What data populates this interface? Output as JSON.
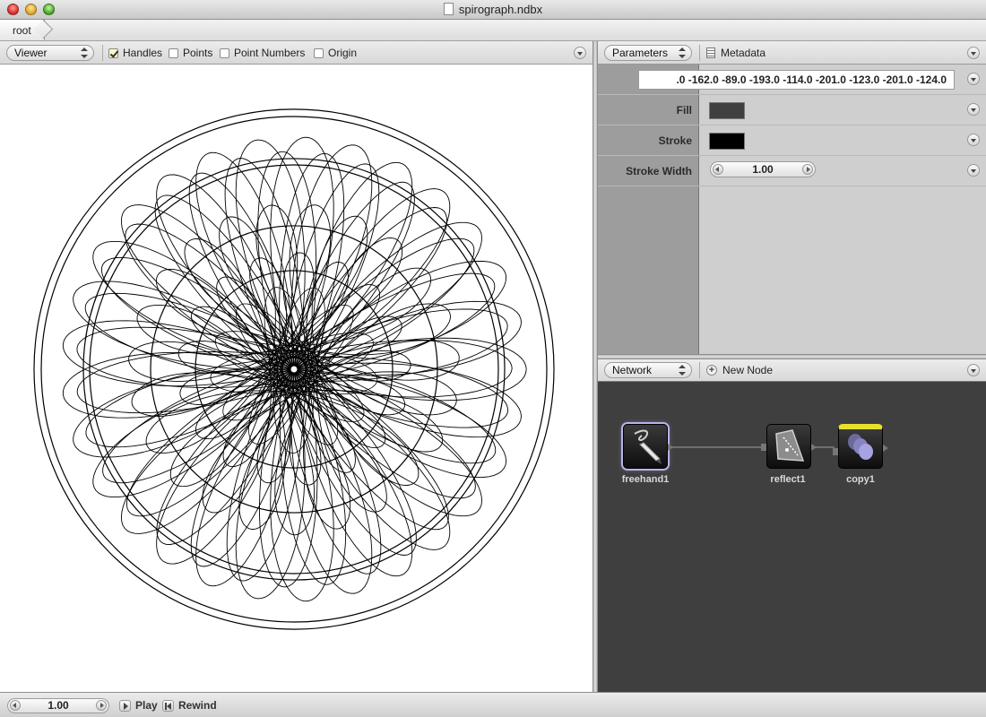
{
  "window": {
    "title": "spirograph.ndbx"
  },
  "breadcrumb": {
    "root": "root"
  },
  "viewer": {
    "selector": "Viewer",
    "options": [
      {
        "label": "Handles",
        "checked": true
      },
      {
        "label": "Points",
        "checked": false
      },
      {
        "label": "Point Numbers",
        "checked": false
      },
      {
        "label": "Origin",
        "checked": false
      }
    ]
  },
  "parameters": {
    "selector": "Parameters",
    "metadata_label": "Metadata",
    "path_value": ".0 -162.0 -89.0 -193.0 -114.0 -201.0 -123.0 -201.0 -124.0",
    "fill_label": "Fill",
    "fill_color": "#404040",
    "stroke_label": "Stroke",
    "stroke_color": "#000000",
    "stroke_width_label": "Stroke Width",
    "stroke_width_value": "1.00"
  },
  "network": {
    "selector": "Network",
    "new_node_label": "New Node",
    "nodes": [
      {
        "name": "freehand1",
        "icon": "pen-icon",
        "selected": true,
        "rendered": false
      },
      {
        "name": "reflect1",
        "icon": "reflect-icon",
        "selected": false,
        "rendered": false
      },
      {
        "name": "copy1",
        "icon": "copy-icon",
        "selected": false,
        "rendered": true
      }
    ]
  },
  "playback": {
    "frame": "1.00",
    "play_label": "Play",
    "rewind_label": "Rewind"
  }
}
